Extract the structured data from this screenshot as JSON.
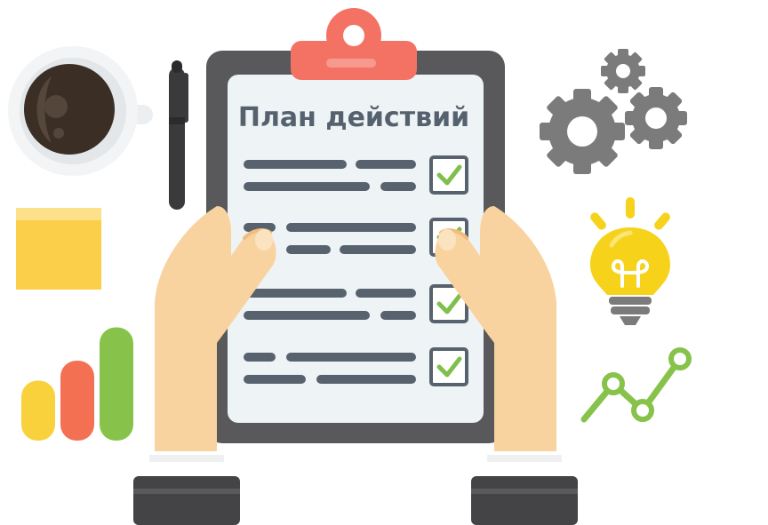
{
  "clipboard": {
    "title": "План действий"
  },
  "checklist": [
    {
      "checked": true
    },
    {
      "checked": true
    },
    {
      "checked": true
    },
    {
      "checked": true
    }
  ],
  "bar_chart": {
    "values": [
      0.45,
      0.6,
      0.85
    ]
  },
  "colors": {
    "clipboard_frame": "#59595b",
    "clip": "#f47264",
    "paper": "#eef3f6",
    "line": "#58626e",
    "check": "#7fbf4d",
    "skin": "#f9d39f",
    "cuff": "#444446",
    "bar_yellow": "#f9d13d",
    "bar_red": "#f47053",
    "bar_green": "#87c34b",
    "sticky_note": "#fbcf49",
    "gear": "#7b7b7b",
    "bulb": "#f6d21a",
    "trend_line": "#87c34b",
    "coffee": "#3a2e25"
  }
}
